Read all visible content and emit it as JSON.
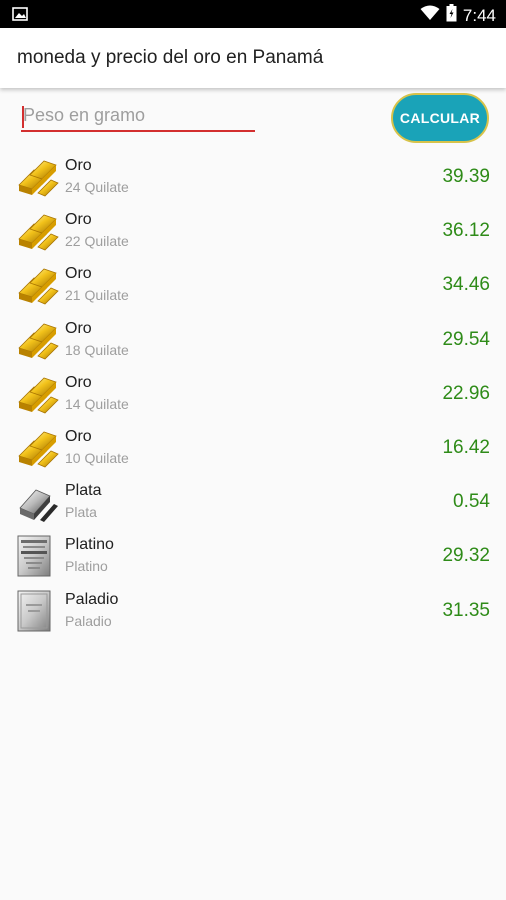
{
  "status_bar": {
    "time": "7:44",
    "left_icon": "image-icon",
    "right_icons": [
      "wifi-icon",
      "battery-icon"
    ]
  },
  "app_bar": {
    "title": "moneda y precio del oro en Panamá"
  },
  "form": {
    "weight_placeholder": "Peso en gramo",
    "weight_value": "",
    "calculate_label": "CALCULAR"
  },
  "colors": {
    "accent": "#1aa3b8",
    "button_border": "#d7c34a",
    "input_underline": "#d32f2f",
    "price_green": "#2e8b18"
  },
  "metals": [
    {
      "name": "Oro",
      "subtitle": "24 Quilate",
      "price": "39.39",
      "icon": "gold-bars-icon"
    },
    {
      "name": "Oro",
      "subtitle": "22 Quilate",
      "price": "36.12",
      "icon": "gold-bars-icon"
    },
    {
      "name": "Oro",
      "subtitle": "21 Quilate",
      "price": "34.46",
      "icon": "gold-bars-icon"
    },
    {
      "name": "Oro",
      "subtitle": "18 Quilate",
      "price": "29.54",
      "icon": "gold-bars-icon"
    },
    {
      "name": "Oro",
      "subtitle": "14 Quilate",
      "price": "22.96",
      "icon": "gold-bars-icon"
    },
    {
      "name": "Oro",
      "subtitle": "10 Quilate",
      "price": "16.42",
      "icon": "gold-bars-icon"
    },
    {
      "name": "Plata",
      "subtitle": "Plata",
      "price": "0.54",
      "icon": "silver-bar-icon"
    },
    {
      "name": "Platino",
      "subtitle": "Platino",
      "price": "29.32",
      "icon": "platinum-bar-icon"
    },
    {
      "name": "Paladio",
      "subtitle": "Paladio",
      "price": "31.35",
      "icon": "palladium-bar-icon"
    }
  ]
}
